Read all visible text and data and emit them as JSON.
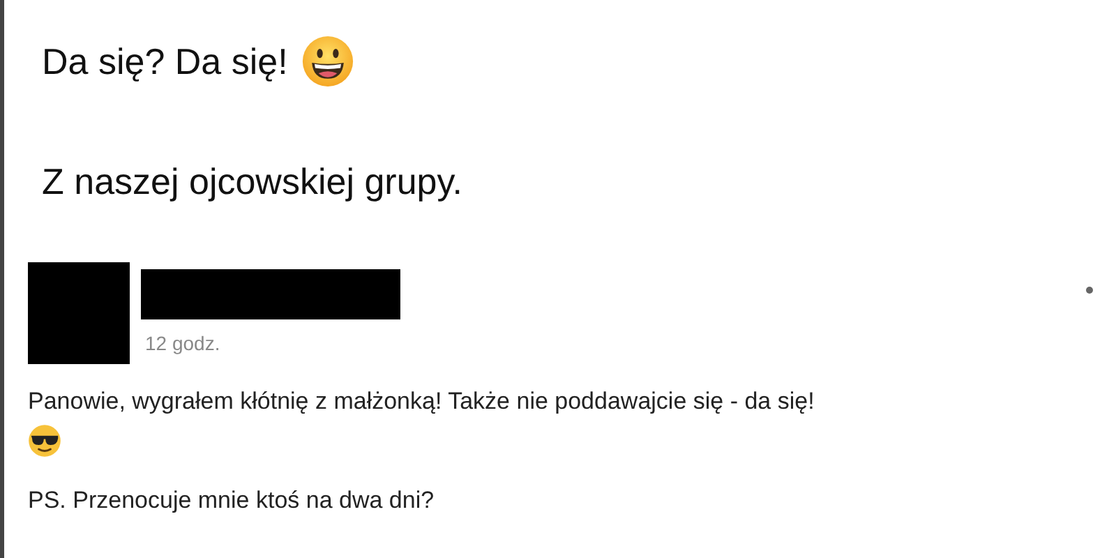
{
  "caption": {
    "lines": [
      "Da się? Da się!",
      "Z naszej ojcowskiej grupy."
    ]
  },
  "post": {
    "time": "12 godz.",
    "paragraphs": [
      "Panowie, wygrałem kłótnię z małżonką! Także nie poddawajcie się - da się!",
      "PS. Przenocuje mnie ktoś na dwa dni?"
    ]
  }
}
